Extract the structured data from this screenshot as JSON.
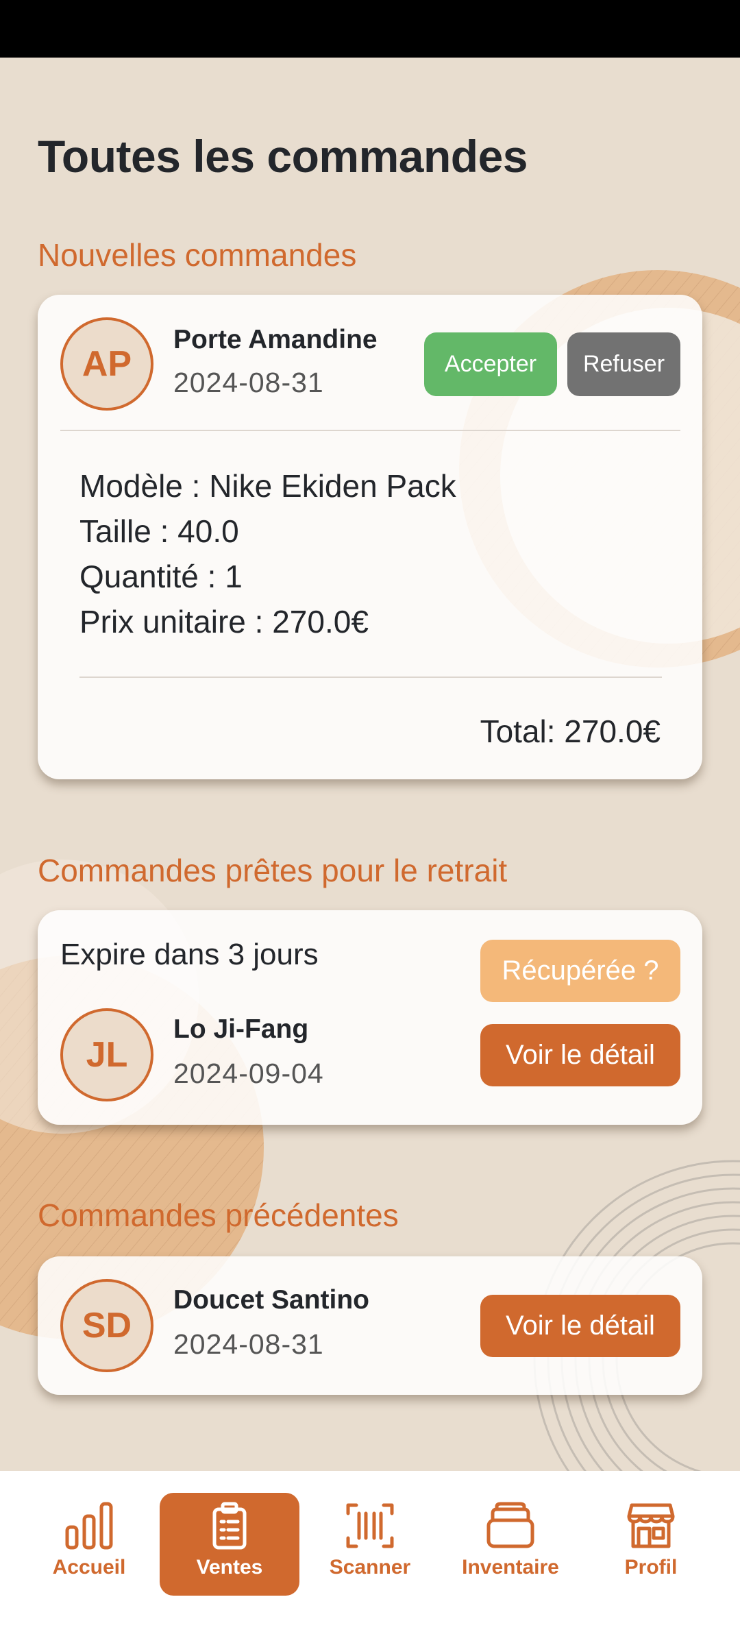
{
  "page": {
    "title": "Toutes les commandes"
  },
  "colors": {
    "accent": "#d0692e",
    "accept": "#63b868",
    "refuse": "#727272",
    "pickup": "#f4b879",
    "background": "#e8ddcf"
  },
  "new_orders": {
    "section_title": "Nouvelles commandes",
    "order": {
      "initials": "AP",
      "name": "Porte Amandine",
      "date": "2024-08-31",
      "accept_label": "Accepter",
      "refuse_label": "Refuser",
      "model": "Modèle : Nike Ekiden Pack",
      "size": "Taille : 40.0",
      "quantity": "Quantité : 1",
      "unit_price": "Prix unitaire : 270.0€",
      "total": "Total: 270.0€"
    }
  },
  "ready_orders": {
    "section_title": "Commandes prêtes pour le retrait",
    "order": {
      "expiry": "Expire dans 3 jours",
      "picked_label": "Récupérée ?",
      "initials": "JL",
      "name": "Lo Ji-Fang",
      "date": "2024-09-04",
      "detail_label": "Voir le détail"
    }
  },
  "previous_orders": {
    "section_title": "Commandes précédentes",
    "order": {
      "initials": "SD",
      "name": "Doucet Santino",
      "date": "2024-08-31",
      "detail_label": "Voir le détail"
    }
  },
  "nav": {
    "items": [
      {
        "label": "Accueil",
        "icon": "bar-chart-icon"
      },
      {
        "label": "Ventes",
        "icon": "clipboard-list-icon"
      },
      {
        "label": "Scanner",
        "icon": "barcode-scan-icon"
      },
      {
        "label": "Inventaire",
        "icon": "box-stack-icon"
      },
      {
        "label": "Profil",
        "icon": "storefront-icon"
      }
    ],
    "active": "Ventes"
  }
}
